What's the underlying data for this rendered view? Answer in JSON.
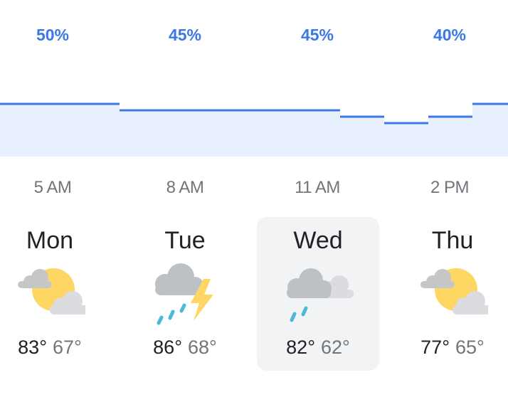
{
  "precipitation": {
    "labels": [
      "50%",
      "45%",
      "45%",
      "40%"
    ],
    "accent_color": "#3b78e7",
    "fill_color": "#e8f0fd",
    "levels": [
      50,
      45,
      45,
      45,
      40,
      35,
      40,
      50
    ]
  },
  "hours": [
    "5 AM",
    "8 AM",
    "11 AM",
    "2 PM"
  ],
  "days": [
    {
      "name": "Mon",
      "high": "83°",
      "low": "67°",
      "icon": "partly-cloudy-icon",
      "selected": false
    },
    {
      "name": "Tue",
      "high": "86°",
      "low": "68°",
      "icon": "thunderstorm-icon",
      "selected": false
    },
    {
      "name": "Wed",
      "high": "82°",
      "low": "62°",
      "icon": "showers-icon",
      "selected": true
    },
    {
      "name": "Thu",
      "high": "77°",
      "low": "65°",
      "icon": "partly-cloudy-icon",
      "selected": false
    }
  ]
}
